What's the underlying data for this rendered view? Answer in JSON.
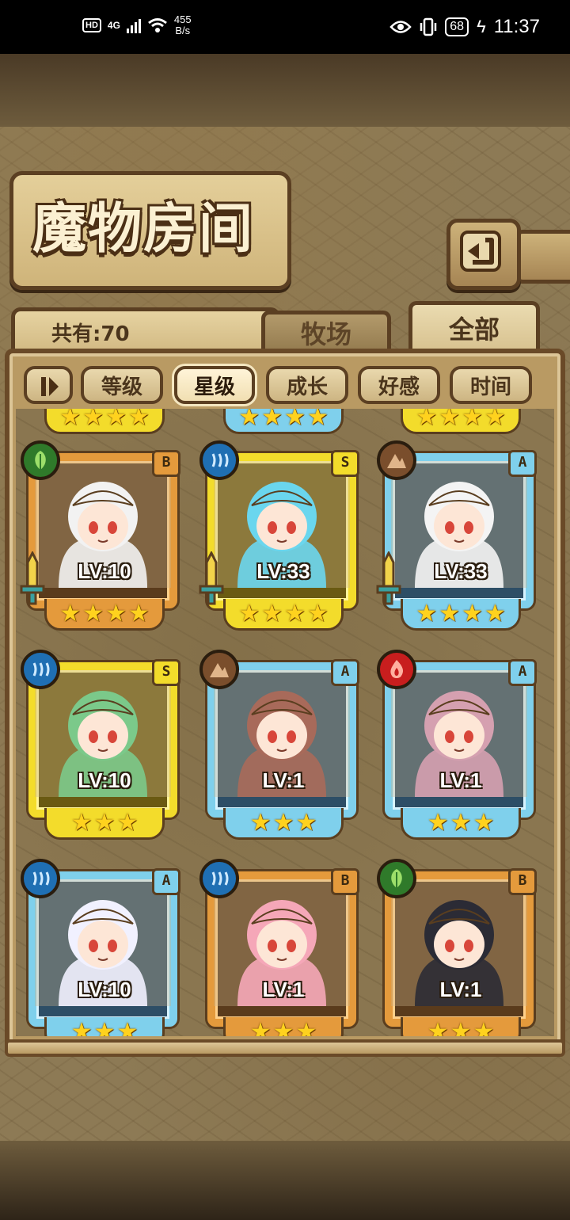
{
  "status_bar": {
    "hd": "HD",
    "signal": "4G",
    "net_speed_value": "455",
    "net_speed_unit": "B/s",
    "battery": "68",
    "time": "11:37"
  },
  "header": {
    "title": "魔物房间",
    "count_label": "共有:70"
  },
  "tabs": [
    {
      "label": "牧场",
      "active": false
    },
    {
      "label": "全部",
      "active": true
    }
  ],
  "sort": {
    "buttons": [
      {
        "label": "等级",
        "active": false
      },
      {
        "label": "星级",
        "active": true
      },
      {
        "label": "成长",
        "active": false
      },
      {
        "label": "好感",
        "active": false
      },
      {
        "label": "时间",
        "active": false
      }
    ]
  },
  "monsters": [
    {
      "rank": "B",
      "element": "leaf-icon",
      "level": "LV:10",
      "stars": 4,
      "frame": "bronze",
      "weapon": true
    },
    {
      "rank": "S",
      "element": "water-icon",
      "level": "LV:33",
      "stars": 4,
      "frame": "gold",
      "weapon": true
    },
    {
      "rank": "A",
      "element": "earth-icon",
      "level": "LV:33",
      "stars": 4,
      "frame": "blue",
      "weapon": true
    },
    {
      "rank": "S",
      "element": "water-icon",
      "level": "LV:10",
      "stars": 3,
      "frame": "gold",
      "weapon": false
    },
    {
      "rank": "A",
      "element": "earth-icon",
      "level": "LV:1",
      "stars": 3,
      "frame": "blue",
      "weapon": false
    },
    {
      "rank": "A",
      "element": "fire-icon",
      "level": "LV:1",
      "stars": 3,
      "frame": "blue",
      "weapon": false
    },
    {
      "rank": "A",
      "element": "water-icon",
      "level": "LV:10",
      "stars": 3,
      "frame": "blue",
      "weapon": false
    },
    {
      "rank": "B",
      "element": "water-icon",
      "level": "LV:1",
      "stars": 3,
      "frame": "bronze",
      "weapon": false
    },
    {
      "rank": "B",
      "element": "leaf-icon",
      "level": "LV:1",
      "stars": 3,
      "frame": "bronze",
      "weapon": false
    }
  ],
  "colors": {
    "bronze": "#e49a3c",
    "gold": "#f3dc2b",
    "blue": "#7fd0ec",
    "leaf": "#2f7a2a",
    "water": "#1f6fb3",
    "earth": "#7a4e2c",
    "fire": "#c81e1e"
  }
}
